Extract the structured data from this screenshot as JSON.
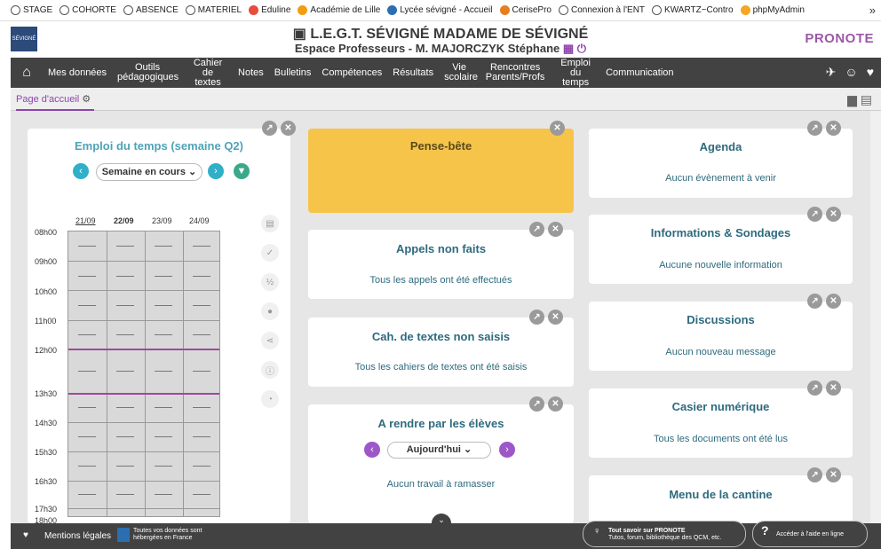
{
  "bookmarks": [
    "STAGE",
    "COHORTE",
    "ABSENCE",
    "MATERIEL",
    "Eduline",
    "Académie de Lille",
    "Lycée sévigné - Accueil",
    "CerisePro",
    "Connexion à l'ENT",
    "KWARTZ~Contro",
    "phpMyAdmin"
  ],
  "header": {
    "school": "L.E.G.T. SÉVIGNÉ MADAME DE SÉVIGNÉ",
    "space": "Espace Professeurs - M. MAJORCZYK Stéphane",
    "brand": "PRONOTE",
    "logo_text": "SÉVIGNÉ"
  },
  "nav": [
    "Mes données",
    "Outils pédagogiques",
    "Cahier de textes",
    "Notes",
    "Bulletins",
    "Compétences",
    "Résultats",
    "Vie scolaire",
    "Rencontres Parents/Profs",
    "Emploi du temps",
    "Communication"
  ],
  "subtab": "Page d'accueil",
  "edt": {
    "title": "Emploi du temps (semaine Q2)",
    "week_select": "Semaine en cours",
    "days": [
      "21/09",
      "22/09",
      "23/09",
      "24/09"
    ],
    "hours": [
      "08h00",
      "09h00",
      "10h00",
      "11h00",
      "12h00",
      "13h30",
      "14h30",
      "15h30",
      "16h30",
      "17h30",
      "18h00"
    ]
  },
  "cards": {
    "pense": {
      "title": "Pense-bête"
    },
    "appels": {
      "title": "Appels non faits",
      "msg": "Tous les appels ont été effectués"
    },
    "cahiers": {
      "title": "Cah. de textes non saisis",
      "msg": "Tous les cahiers de textes ont été saisis"
    },
    "rendre": {
      "title": "A rendre par les élèves",
      "select": "Aujourd'hui",
      "msg": "Aucun travail à ramasser"
    },
    "agenda": {
      "title": "Agenda",
      "msg": "Aucun évènement à venir"
    },
    "infos": {
      "title": "Informations & Sondages",
      "msg": "Aucune nouvelle information"
    },
    "discussions": {
      "title": "Discussions",
      "msg": "Aucun nouveau message"
    },
    "casier": {
      "title": "Casier numérique",
      "msg": "Tous les documents ont été lus"
    },
    "cantine": {
      "title": "Menu de la cantine"
    }
  },
  "footer": {
    "mentions": "Mentions légales",
    "hosted_1": "Toutes vos données sont",
    "hosted_2": "hébergées en France",
    "tout_1": "Tout savoir sur PRONOTE",
    "tout_2": "Tutos, forum, bibliothèque des QCM, etc.",
    "aide": "Accéder à l'aide en ligne"
  }
}
